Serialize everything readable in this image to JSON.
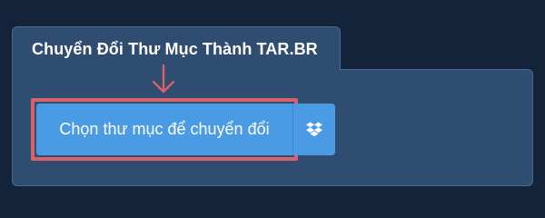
{
  "header": {
    "title": "Chuyển Đổi Thư Mục Thành TAR.BR"
  },
  "actions": {
    "choose_folder_label": "Chọn thư mục để chuyển đổi",
    "dropbox_icon": "dropbox-icon"
  },
  "colors": {
    "background": "#13243a",
    "panel": "#2e4d70",
    "button": "#4a9be3",
    "highlight": "#d9616a"
  }
}
